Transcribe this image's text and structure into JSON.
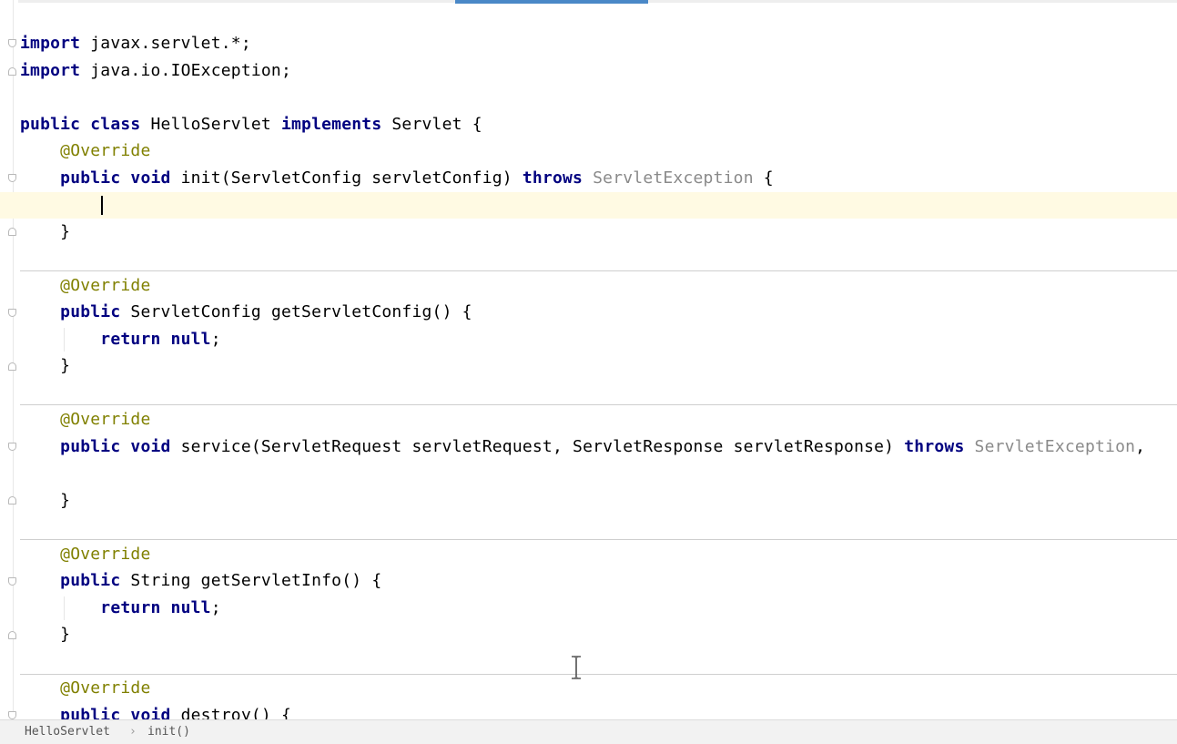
{
  "editor": {
    "lines": [
      {
        "tokens": [
          {
            "t": "import",
            "c": "kw"
          },
          {
            "t": " javax.servlet.*;",
            "c": "plain"
          }
        ]
      },
      {
        "tokens": [
          {
            "t": "import",
            "c": "kw"
          },
          {
            "t": " java.io.IOException;",
            "c": "plain"
          }
        ]
      },
      {
        "tokens": []
      },
      {
        "tokens": [
          {
            "t": "public class",
            "c": "kw"
          },
          {
            "t": " HelloServlet ",
            "c": "plain"
          },
          {
            "t": "implements",
            "c": "kw"
          },
          {
            "t": " Servlet {",
            "c": "plain"
          }
        ]
      },
      {
        "tokens": [
          {
            "t": "    ",
            "c": "plain"
          },
          {
            "t": "@Override",
            "c": "ann"
          }
        ]
      },
      {
        "tokens": [
          {
            "t": "    ",
            "c": "plain"
          },
          {
            "t": "public void",
            "c": "kw"
          },
          {
            "t": " init(ServletConfig servletConfig) ",
            "c": "plain"
          },
          {
            "t": "throws",
            "c": "kw"
          },
          {
            "t": " ",
            "c": "plain"
          },
          {
            "t": "ServletException",
            "c": "exc"
          },
          {
            "t": " {",
            "c": "plain"
          }
        ]
      },
      {
        "tokens": []
      },
      {
        "tokens": [
          {
            "t": "    }",
            "c": "plain"
          }
        ]
      },
      {
        "tokens": []
      },
      {
        "tokens": [
          {
            "t": "    ",
            "c": "plain"
          },
          {
            "t": "@Override",
            "c": "ann"
          }
        ]
      },
      {
        "tokens": [
          {
            "t": "    ",
            "c": "plain"
          },
          {
            "t": "public",
            "c": "kw"
          },
          {
            "t": " ServletConfig getServletConfig() {",
            "c": "plain"
          }
        ]
      },
      {
        "tokens": [
          {
            "t": "        ",
            "c": "plain"
          },
          {
            "t": "return null",
            "c": "kw"
          },
          {
            "t": ";",
            "c": "plain"
          }
        ]
      },
      {
        "tokens": [
          {
            "t": "    }",
            "c": "plain"
          }
        ]
      },
      {
        "tokens": []
      },
      {
        "tokens": [
          {
            "t": "    ",
            "c": "plain"
          },
          {
            "t": "@Override",
            "c": "ann"
          }
        ]
      },
      {
        "tokens": [
          {
            "t": "    ",
            "c": "plain"
          },
          {
            "t": "public void",
            "c": "kw"
          },
          {
            "t": " service(ServletRequest servletRequest, ServletResponse servletResponse) ",
            "c": "plain"
          },
          {
            "t": "throws",
            "c": "kw"
          },
          {
            "t": " ",
            "c": "plain"
          },
          {
            "t": "ServletException",
            "c": "exc"
          },
          {
            "t": ",",
            "c": "plain"
          }
        ]
      },
      {
        "tokens": []
      },
      {
        "tokens": [
          {
            "t": "    }",
            "c": "plain"
          }
        ]
      },
      {
        "tokens": []
      },
      {
        "tokens": [
          {
            "t": "    ",
            "c": "plain"
          },
          {
            "t": "@Override",
            "c": "ann"
          }
        ]
      },
      {
        "tokens": [
          {
            "t": "    ",
            "c": "plain"
          },
          {
            "t": "public",
            "c": "kw"
          },
          {
            "t": " String getServletInfo() {",
            "c": "plain"
          }
        ]
      },
      {
        "tokens": [
          {
            "t": "        ",
            "c": "plain"
          },
          {
            "t": "return null",
            "c": "kw"
          },
          {
            "t": ";",
            "c": "plain"
          }
        ]
      },
      {
        "tokens": [
          {
            "t": "    }",
            "c": "plain"
          }
        ]
      },
      {
        "tokens": []
      },
      {
        "tokens": [
          {
            "t": "    ",
            "c": "plain"
          },
          {
            "t": "@Override",
            "c": "ann"
          }
        ]
      },
      {
        "tokens": [
          {
            "t": "    ",
            "c": "plain"
          },
          {
            "t": "public void",
            "c": "kw"
          },
          {
            "t": " destroy() {",
            "c": "plain"
          }
        ]
      }
    ]
  },
  "colors": {
    "keyword": "#000080",
    "annotation": "#808000",
    "unused_exception": "#8a8a8a",
    "current_line_highlight": "#fffae3",
    "active_tab_indicator": "#4a88c7"
  },
  "breadcrumb": {
    "items": [
      "HelloServlet",
      "init()"
    ],
    "separator": "›"
  }
}
